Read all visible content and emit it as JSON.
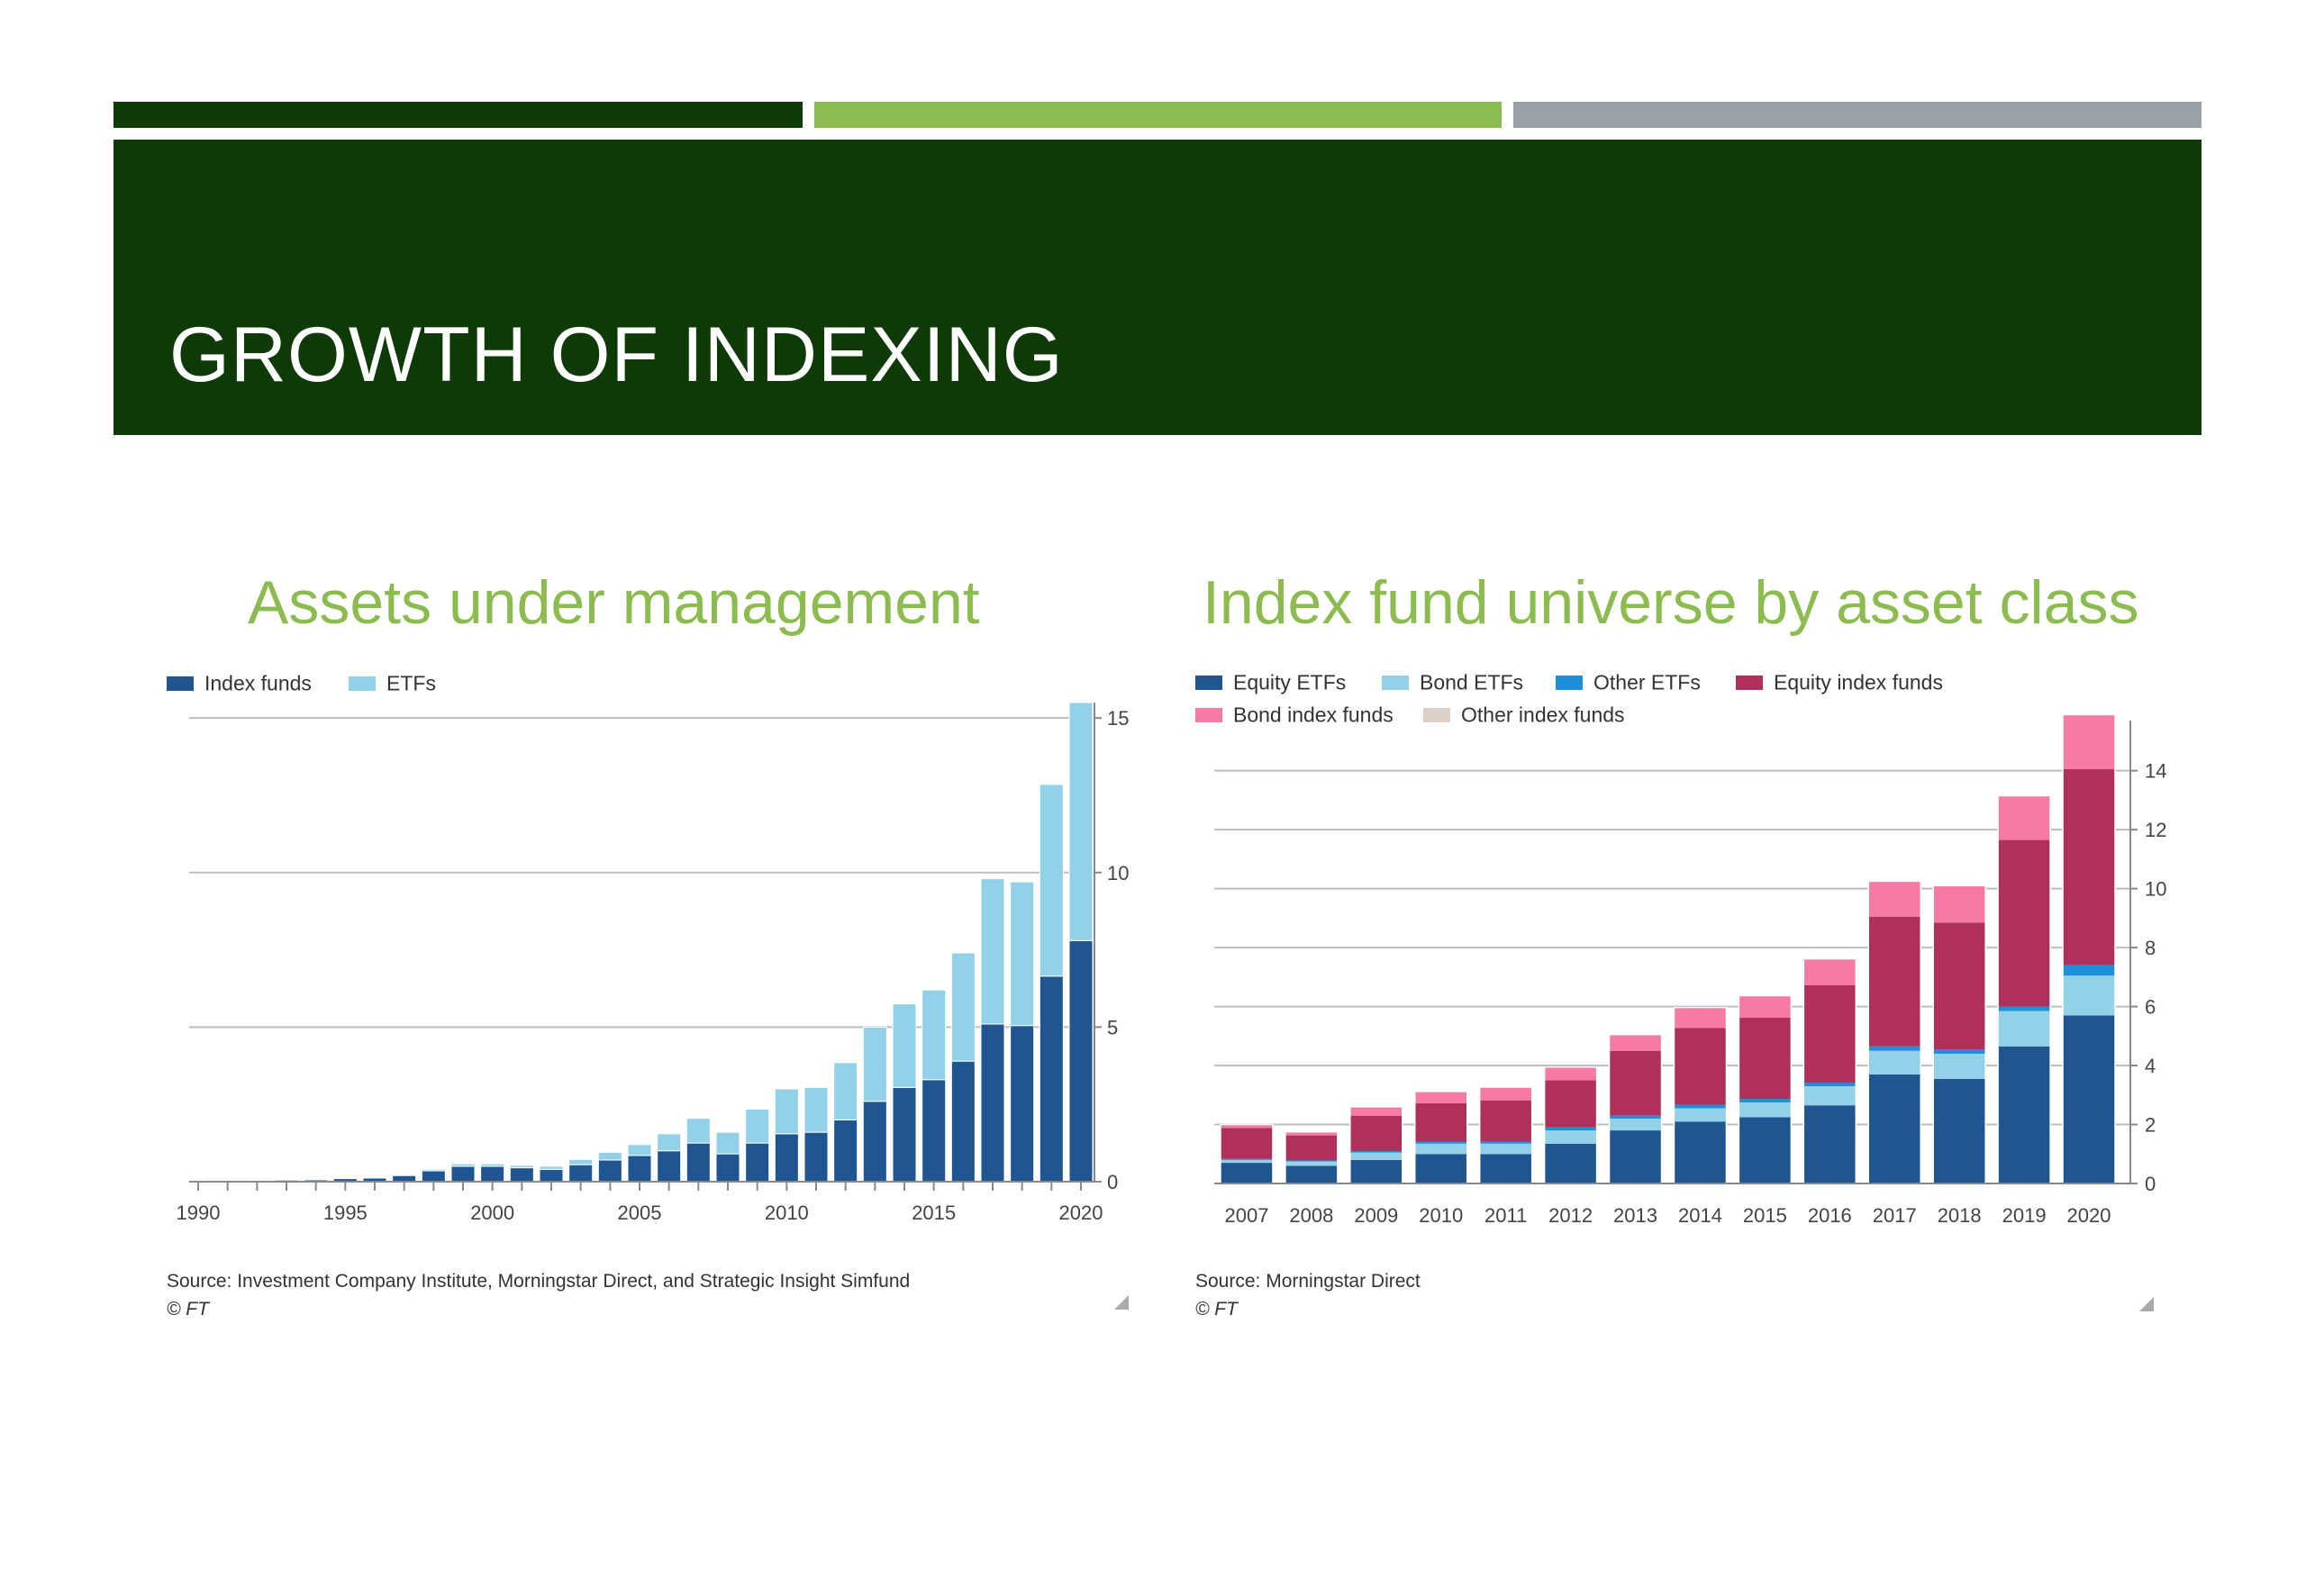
{
  "slide": {
    "title": "GROWTH OF INDEXING"
  },
  "colors": {
    "dark_green": "#0e3b05",
    "light_green": "#8cbc4f",
    "grey": "#9aa1a6",
    "index_funds": "#1f5591",
    "etfs": "#92d1e8",
    "equity_etfs": "#1f5591",
    "bond_etfs": "#92d1e8",
    "other_etfs": "#1e8fd8",
    "equity_index_funds": "#b0305d",
    "bond_index_funds": "#f77aa5",
    "other_index_funds": "#dcd0c8"
  },
  "chart_data": [
    {
      "type": "bar",
      "stacked": true,
      "title": "Assets under management",
      "legend": [
        "Index funds",
        "ETFs"
      ],
      "categories": [
        "1990",
        "1991",
        "1992",
        "1993",
        "1994",
        "1995",
        "1996",
        "1997",
        "1998",
        "1999",
        "2000",
        "2001",
        "2002",
        "2003",
        "2004",
        "2005",
        "2006",
        "2007",
        "2008",
        "2009",
        "2010",
        "2011",
        "2012",
        "2013",
        "2014",
        "2015",
        "2016",
        "2017",
        "2018",
        "2019",
        "2020"
      ],
      "x_tick_labels": [
        "1990",
        "1995",
        "2000",
        "2005",
        "2010",
        "2015",
        "2020"
      ],
      "series": [
        {
          "name": "Index funds",
          "values": [
            0.02,
            0.03,
            0.04,
            0.05,
            0.06,
            0.1,
            0.12,
            0.2,
            0.35,
            0.5,
            0.5,
            0.45,
            0.4,
            0.55,
            0.7,
            0.85,
            1.0,
            1.25,
            0.9,
            1.25,
            1.55,
            1.6,
            2.0,
            2.6,
            3.05,
            3.3,
            3.9,
            5.1,
            5.05,
            6.65,
            7.8
          ]
        },
        {
          "name": "ETFs",
          "values": [
            0,
            0,
            0,
            0,
            0.01,
            0.01,
            0.02,
            0.03,
            0.05,
            0.08,
            0.08,
            0.08,
            0.1,
            0.17,
            0.25,
            0.35,
            0.55,
            0.8,
            0.7,
            1.1,
            1.45,
            1.45,
            1.85,
            2.4,
            2.7,
            2.9,
            3.5,
            4.7,
            4.65,
            6.2,
            7.7
          ]
        }
      ],
      "ylim": [
        0,
        15.5
      ],
      "y_ticks": [
        0,
        5,
        10,
        15
      ],
      "y_axis_side": "right",
      "grid": true,
      "legend_position": "top-left",
      "source": "Source: Investment Company Institute, Morningstar Direct, and Strategic Insight Simfund",
      "copyright": "© FT"
    },
    {
      "type": "bar",
      "stacked": true,
      "title": "Index fund universe by asset class",
      "legend": [
        "Equity ETFs",
        "Bond ETFs",
        "Other ETFs",
        "Equity index funds",
        "Bond index funds",
        "Other index funds"
      ],
      "categories": [
        "2007",
        "2008",
        "2009",
        "2010",
        "2011",
        "2012",
        "2013",
        "2014",
        "2015",
        "2016",
        "2017",
        "2018",
        "2019",
        "2020"
      ],
      "series": [
        {
          "name": "Equity ETFs",
          "values": [
            0.7,
            0.6,
            0.8,
            1.0,
            1.0,
            1.35,
            1.8,
            2.1,
            2.25,
            2.65,
            3.7,
            3.55,
            4.65,
            5.7
          ]
        },
        {
          "name": "Bond ETFs",
          "values": [
            0.1,
            0.15,
            0.25,
            0.35,
            0.35,
            0.45,
            0.4,
            0.45,
            0.5,
            0.65,
            0.8,
            0.85,
            1.2,
            1.35
          ]
        },
        {
          "name": "Other ETFs",
          "values": [
            0.03,
            0.03,
            0.05,
            0.07,
            0.07,
            0.1,
            0.1,
            0.12,
            0.12,
            0.12,
            0.15,
            0.15,
            0.15,
            0.35
          ]
        },
        {
          "name": "Equity index funds",
          "values": [
            1.05,
            0.85,
            1.2,
            1.3,
            1.4,
            1.6,
            2.2,
            2.6,
            2.75,
            3.3,
            4.4,
            4.3,
            5.65,
            6.65
          ]
        },
        {
          "name": "Bond index funds",
          "values": [
            0.12,
            0.12,
            0.3,
            0.4,
            0.45,
            0.45,
            0.55,
            0.7,
            0.75,
            0.9,
            1.2,
            1.25,
            1.5,
            1.85
          ]
        },
        {
          "name": "Other index funds",
          "values": [
            0,
            0,
            0,
            0,
            0,
            0,
            0,
            0,
            0,
            0,
            0,
            0,
            0,
            0
          ]
        }
      ],
      "ylim": [
        0,
        15.7
      ],
      "y_ticks": [
        0,
        2,
        4,
        6,
        8,
        10,
        12,
        14
      ],
      "y_axis_side": "right",
      "grid": true,
      "legend_position": "top-left",
      "source": "Source: Morningstar Direct",
      "copyright": "© FT"
    }
  ]
}
